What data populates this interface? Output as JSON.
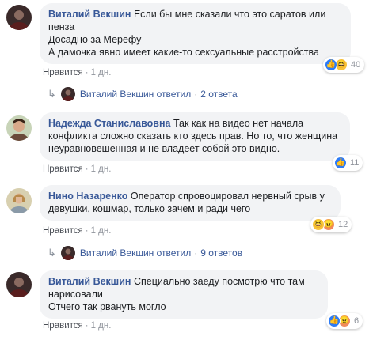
{
  "colors": {
    "bubble": "#f2f3f5",
    "author": "#385898",
    "meta": "#90949c",
    "like": "#2e7cf6"
  },
  "comments": [
    {
      "author": "Виталий Векшин",
      "lines": [
        "Если бы мне сказали что это саратов или",
        "пенза",
        "Досадно за Мерефу",
        "А дамочка явно имеет какие-то сексуальные расстройства"
      ],
      "like_label": "Нравится",
      "time": "1 дн.",
      "reactions": [
        "like-icon",
        "haha-icon"
      ],
      "reaction_count": "40"
    },
    {
      "author": "Надежда Станиславовна",
      "lines": [
        "Так как на видео нет начала",
        "конфликта сложно сказать кто здесь прав. Но то, что женщина",
        "неуравновешенная и не владеет собой это видно."
      ],
      "like_label": "Нравится",
      "time": "1 дн.",
      "reactions": [
        "like-icon"
      ],
      "reaction_count": "11"
    },
    {
      "author": "Нино Назаренко",
      "lines": [
        "Оператор спровоцировал нервный срыв у",
        "девушки, кошмар, только зачем и ради чего"
      ],
      "like_label": "Нравится",
      "time": "1 дн.",
      "reactions": [
        "haha-icon",
        "angry-icon"
      ],
      "reaction_count": "12"
    },
    {
      "author": "Виталий Векшин",
      "lines": [
        "Специально заеду посмотрю что там",
        "нарисовали",
        "Отчего так рвануть могло"
      ],
      "like_label": "Нравится",
      "time": "1 дн.",
      "reactions": [
        "like-icon",
        "angry-icon"
      ],
      "reaction_count": "6"
    }
  ],
  "replies": [
    {
      "author": "Виталий Векшин",
      "verb": "ответил",
      "count": "2 ответа"
    },
    {
      "author": "Виталий Векшин",
      "verb": "ответил",
      "count": "9 ответов"
    }
  ]
}
